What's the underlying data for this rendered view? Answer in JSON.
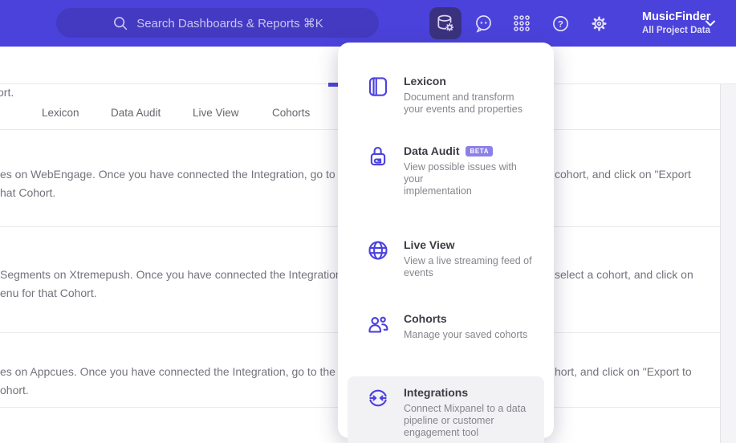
{
  "colors": {
    "header_purple": "#4b42dc",
    "accent_purple": "#4b42e0",
    "badge_purple": "#8c80e8",
    "highlight_gray": "#f2f2f4"
  },
  "topbar": {
    "search": {
      "placeholder": "Search Dashboards & Reports ⌘K"
    },
    "icons": [
      {
        "name": "data-management",
        "active": true
      },
      {
        "name": "feedback",
        "active": false
      },
      {
        "name": "apps-grid",
        "active": false
      },
      {
        "name": "help",
        "active": false
      },
      {
        "name": "settings",
        "active": false
      }
    ],
    "project": {
      "name": "MusicFinder",
      "scope": "All Project Data"
    }
  },
  "tabs": [
    {
      "label": "Lexicon"
    },
    {
      "label": "Data Audit"
    },
    {
      "label": "Live View"
    },
    {
      "label": "Cohorts"
    }
  ],
  "menu": {
    "items": [
      {
        "icon": "lexicon-book",
        "title": "Lexicon",
        "desc": "Document and transform\nyour events and properties"
      },
      {
        "icon": "data-audit-lock",
        "title": "Data Audit",
        "badge": "BETA",
        "desc": "View possible issues with your\nimplementation"
      },
      {
        "icon": "live-view-globe",
        "title": "Live View",
        "desc": "View a live streaming feed of\nevents"
      },
      {
        "icon": "cohorts-people",
        "title": "Cohorts",
        "desc": "Manage your saved cohorts"
      },
      {
        "icon": "integrations-sync",
        "title": "Integrations",
        "desc": "Connect Mixpanel to a data\npipeline or customer\nengagement tool",
        "highlighted": true
      }
    ]
  },
  "content": {
    "rows": [
      {
        "left_line1": "ort.",
        "left_line2": "",
        "right_line1": ""
      },
      {
        "left_line1": "es on WebEngage. Once you have connected the Integration, go to the",
        "left_line2": "hat Cohort.",
        "right_line1": "cohort, and click on \"Export"
      },
      {
        "left_line1": "Segments on Xtremepush. Once you have connected the Integration,",
        "left_line2": "enu for that Cohort.",
        "right_line1": "select a cohort, and click on"
      },
      {
        "left_line1": "es on Appcues. Once you have connected the Integration, go to the M",
        "left_line2": "ohort.",
        "right_line1": "hort, and click on \"Export to"
      }
    ]
  }
}
